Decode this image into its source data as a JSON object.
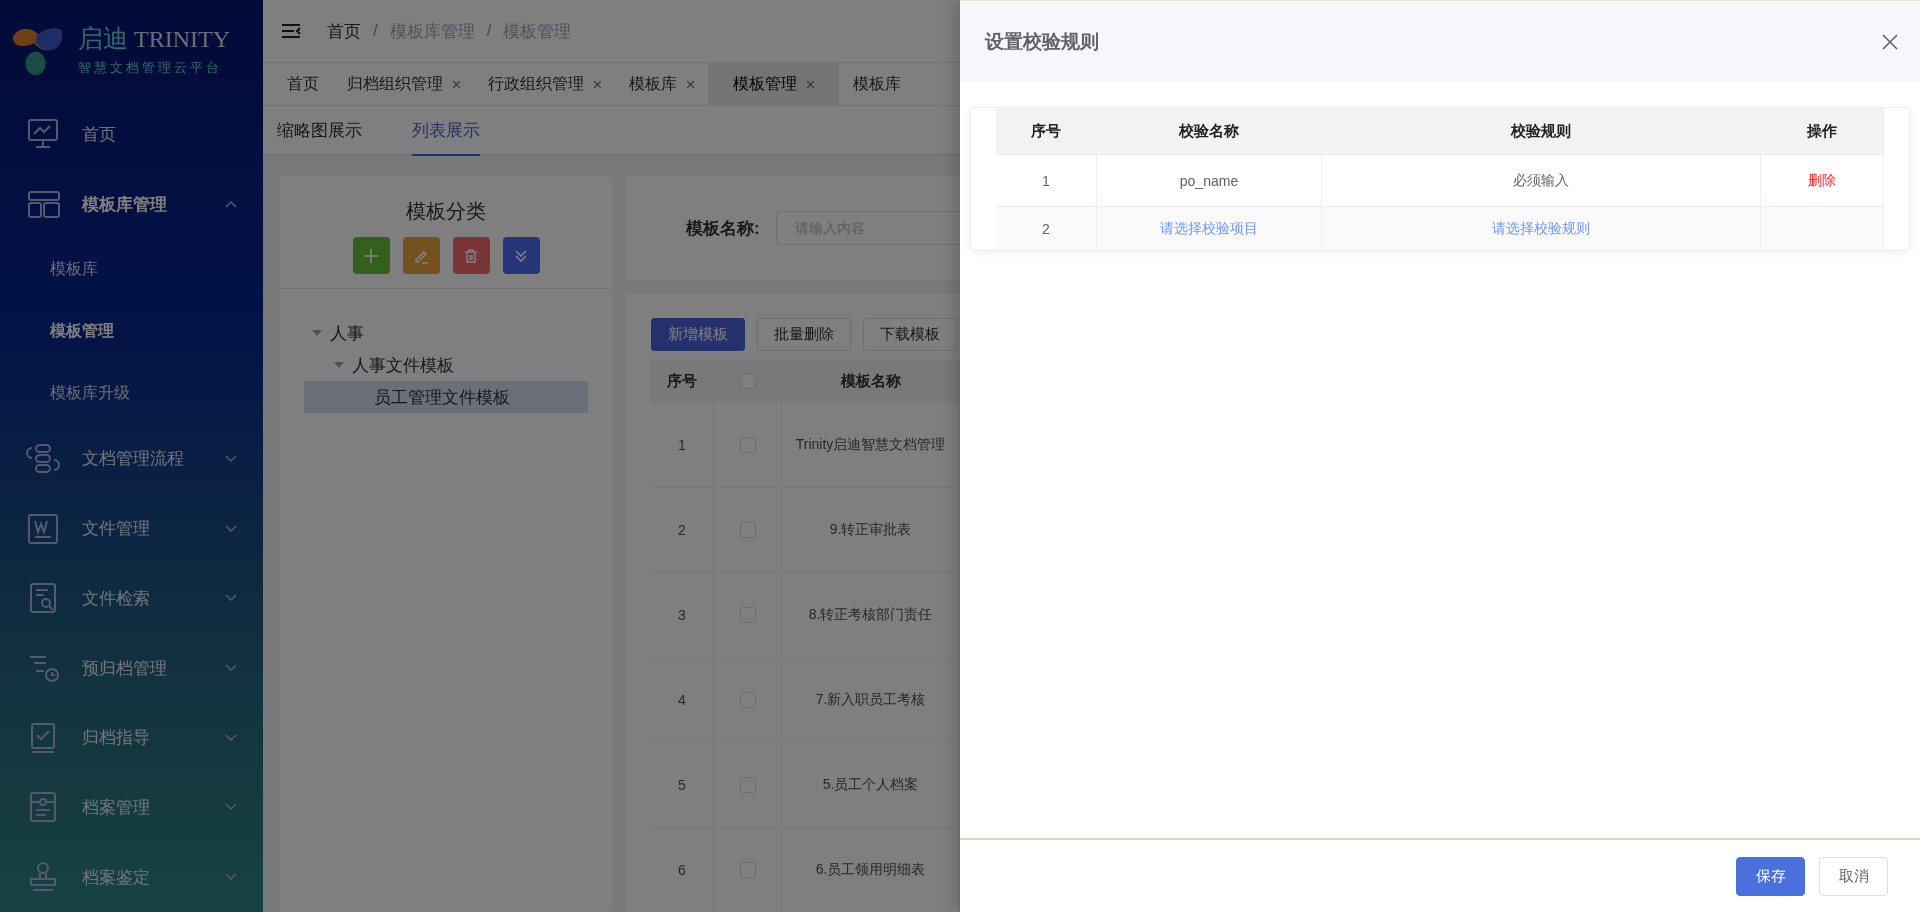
{
  "brand": {
    "name_cn": "启迪",
    "name_en": "TRINITY",
    "tagline": "智慧文档管理云平台"
  },
  "sidebar": {
    "items": [
      {
        "label": "首页",
        "kind": "link",
        "selected": false
      },
      {
        "label": "模板库管理",
        "kind": "group",
        "selected": false,
        "expanded": true,
        "children": [
          {
            "label": "模板库",
            "selected": false
          },
          {
            "label": "模板管理",
            "selected": true
          },
          {
            "label": "模板库升级",
            "selected": false
          }
        ]
      },
      {
        "label": "文档管理流程",
        "kind": "group",
        "selected": false,
        "expanded": false
      },
      {
        "label": "文件管理",
        "kind": "group",
        "selected": false,
        "expanded": false
      },
      {
        "label": "文件检索",
        "kind": "group",
        "selected": false,
        "expanded": false
      },
      {
        "label": "预归档管理",
        "kind": "group",
        "selected": false,
        "expanded": false
      },
      {
        "label": "归档指导",
        "kind": "group",
        "selected": false,
        "expanded": false
      },
      {
        "label": "档案管理",
        "kind": "group",
        "selected": false,
        "expanded": false
      },
      {
        "label": "档案鉴定",
        "kind": "group",
        "selected": false,
        "expanded": false
      }
    ]
  },
  "breadcrumb": {
    "separator": "/",
    "items": [
      "首页",
      "模板库管理",
      "模板管理"
    ]
  },
  "page_tabs": [
    {
      "label": "首页",
      "selected": false,
      "closable": false
    },
    {
      "label": "归档组织管理",
      "selected": false,
      "closable": true
    },
    {
      "label": "行政组织管理",
      "selected": false,
      "closable": true
    },
    {
      "label": "模板库",
      "selected": false,
      "closable": true
    },
    {
      "label": "模板管理",
      "selected": true,
      "closable": true
    },
    {
      "label": "模板库",
      "selected": false,
      "closable": false
    }
  ],
  "view_tabs": [
    {
      "label": "缩略图展示",
      "selected": false
    },
    {
      "label": "列表展示",
      "selected": true
    }
  ],
  "category_panel": {
    "title": "模板分类",
    "actions": [
      {
        "kind": "add"
      },
      {
        "kind": "edit"
      },
      {
        "kind": "delete"
      },
      {
        "kind": "collapse"
      }
    ],
    "tree": [
      {
        "label": "人事",
        "expanded": true,
        "selected": false,
        "children": [
          {
            "label": "人事文件模板",
            "expanded": true,
            "selected": false,
            "children": [
              {
                "label": "员工管理文件模板",
                "selected": true
              }
            ]
          }
        ]
      }
    ]
  },
  "search": {
    "label": "模板名称:",
    "placeholder": "请输入内容"
  },
  "toolbar": [
    {
      "label": "新增模板",
      "kind": "primary"
    },
    {
      "label": "批量删除",
      "kind": "default"
    },
    {
      "label": "下载模板",
      "kind": "default"
    }
  ],
  "table": {
    "columns": [
      {
        "label": "序号",
        "kind": "text"
      },
      {
        "kind": "checkbox",
        "checked": false
      },
      {
        "label": "模板名称",
        "kind": "text"
      }
    ],
    "rows": [
      {
        "index": "1",
        "checked": false,
        "name": "Trinity启迪智慧文档管理"
      },
      {
        "index": "2",
        "checked": false,
        "name": "9.转正审批表"
      },
      {
        "index": "3",
        "checked": false,
        "name": "8.转正考核部门责任"
      },
      {
        "index": "4",
        "checked": false,
        "name": "7.新入职员工考核"
      },
      {
        "index": "5",
        "checked": false,
        "name": "5.员工个人档案"
      },
      {
        "index": "6",
        "checked": false,
        "name": "6.员工领用明细表"
      }
    ]
  },
  "drawer": {
    "title": "设置校验规则",
    "columns": [
      "序号",
      "校验名称",
      "校验规则",
      "操作"
    ],
    "rows": [
      {
        "kind": "entry",
        "index": "1",
        "name": "po_name",
        "rule": "必须输入",
        "action": "删除"
      },
      {
        "kind": "new",
        "index": "2",
        "name": "请选择校验项目",
        "rule": "请选择校验规则"
      }
    ],
    "buttons": [
      {
        "label": "保存",
        "kind": "primary"
      },
      {
        "label": "取消",
        "kind": "default"
      }
    ]
  }
}
